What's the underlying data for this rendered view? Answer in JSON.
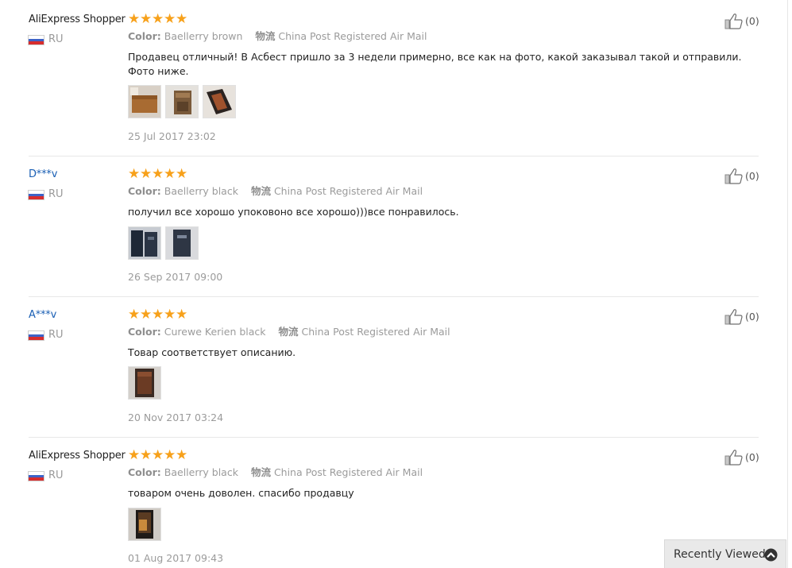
{
  "colors": {
    "star": "#f7a11b",
    "user_link": "#1a5fb4",
    "meta_text": "#9b9b9b",
    "separator": "#e8e8e8"
  },
  "labels": {
    "color_label": "Color:",
    "shipping_label": "物流"
  },
  "reviews": [
    {
      "user": "AliExpress Shopper",
      "country": "RU",
      "rating": 5,
      "color": "Baellerry brown",
      "shipping": "China Post Registered Air Mail",
      "feedback": "Продавец отличный! В Асбест пришло за 3 недели примерно, все как на фото, какой заказывал такой и отправили. Фото ниже.",
      "photos": 3,
      "date": "25 Jul 2017 23:02",
      "useful_count": "(0)"
    },
    {
      "user": "D***v",
      "country": "RU",
      "rating": 5,
      "color": "Baellerry black",
      "shipping": "China Post Registered Air Mail",
      "feedback": "получил все хорошо упоковоно все хорошо)))все понравилось.",
      "photos": 2,
      "date": "26 Sep 2017 09:00",
      "useful_count": "(0)"
    },
    {
      "user": "A***v",
      "country": "RU",
      "rating": 5,
      "color": "Curewe Kerien black",
      "shipping": "China Post Registered Air Mail",
      "feedback": "Товар соответствует описанию.",
      "photos": 1,
      "date": "20 Nov 2017 03:24",
      "useful_count": "(0)"
    },
    {
      "user": "AliExpress Shopper",
      "country": "RU",
      "rating": 5,
      "color": "Baellerry black",
      "shipping": "China Post Registered Air Mail",
      "feedback": "товаром очень доволен. спасибо продавцу",
      "photos": 1,
      "date": "01 Aug 2017 09:43",
      "useful_count": "(0)"
    }
  ],
  "recently_viewed": {
    "label": "Recently Viewed",
    "icon": "chevron-up-circle-icon"
  }
}
